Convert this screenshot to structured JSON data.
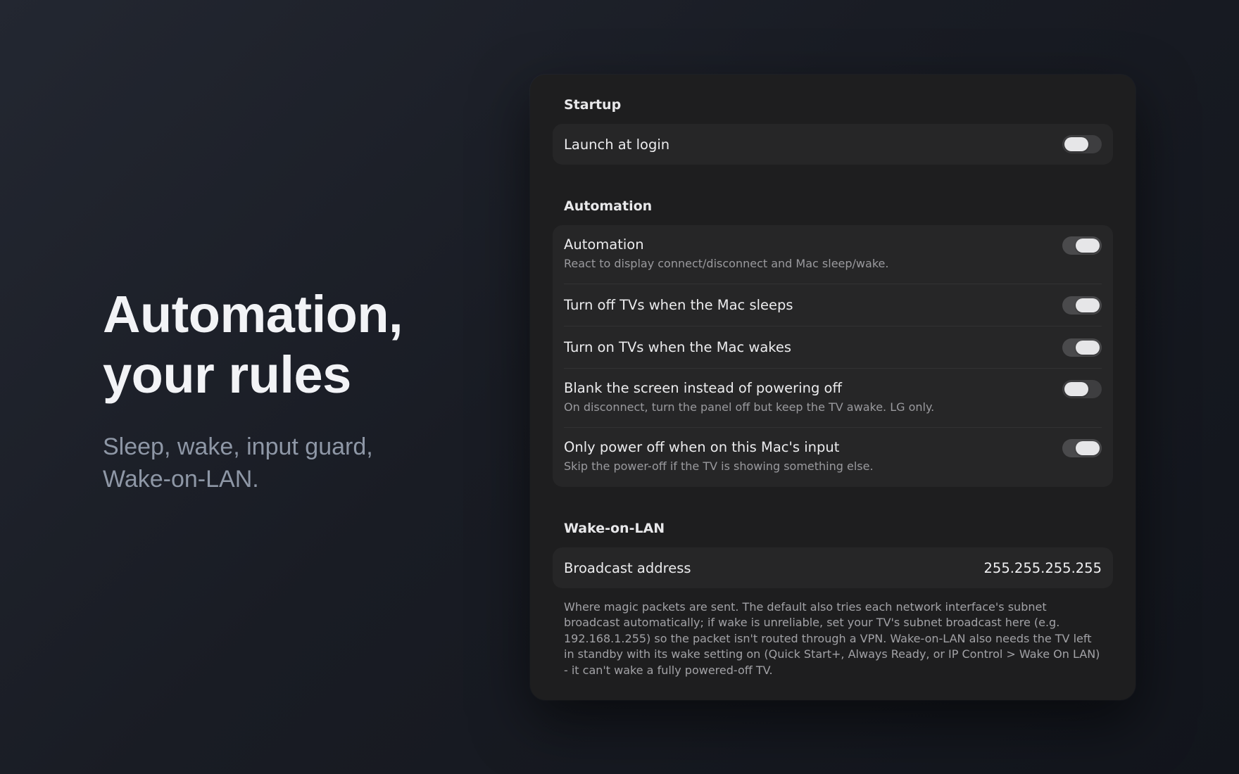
{
  "hero": {
    "title_line1": "Automation,",
    "title_line2": "your rules",
    "subtitle_line1": "Sleep, wake, input guard,",
    "subtitle_line2": "Wake-on-LAN."
  },
  "startup": {
    "title": "Startup",
    "launch_at_login": {
      "label": "Launch at login",
      "enabled": false
    }
  },
  "automation": {
    "title": "Automation",
    "rows": [
      {
        "label": "Automation",
        "description": "React to display connect/disconnect and Mac sleep/wake.",
        "enabled": true
      },
      {
        "label": "Turn off TVs when the Mac sleeps",
        "enabled": true
      },
      {
        "label": "Turn on TVs when the Mac wakes",
        "enabled": true
      },
      {
        "label": "Blank the screen instead of powering off",
        "description": "On disconnect, turn the panel off but keep the TV awake. LG only.",
        "enabled": false
      },
      {
        "label": "Only power off when on this Mac's input",
        "description": "Skip the power-off if the TV is showing something else.",
        "enabled": true
      }
    ]
  },
  "wol": {
    "title": "Wake-on-LAN",
    "broadcast_label": "Broadcast address",
    "broadcast_value": "255.255.255.255",
    "footnote": "Where magic packets are sent. The default also tries each network interface's subnet broadcast automatically; if wake is unreliable, set your TV's subnet broadcast here (e.g. 192.168.1.255) so the packet isn't routed through a VPN. Wake-on-LAN also needs the TV left in standby with its wake setting on (Quick Start+, Always Ready, or IP Control > Wake On LAN) - it can't wake a fully powered-off TV."
  }
}
